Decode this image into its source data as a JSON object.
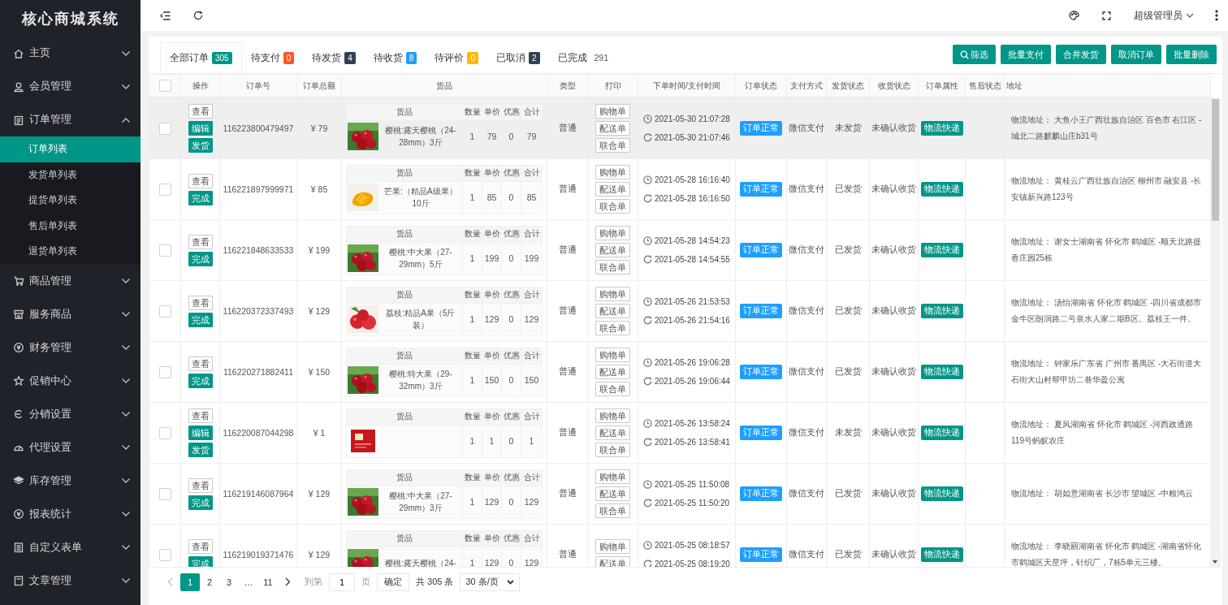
{
  "sidebar": {
    "logo": "核心商城系统",
    "items": [
      {
        "label": "主页",
        "expanded": false
      },
      {
        "label": "会员管理",
        "expanded": false
      },
      {
        "label": "订单管理",
        "expanded": true,
        "children": [
          {
            "label": "订单列表",
            "selected": true
          },
          {
            "label": "发货单列表",
            "selected": false
          },
          {
            "label": "提货单列表",
            "selected": false
          },
          {
            "label": "售后单列表",
            "selected": false
          },
          {
            "label": "退货单列表",
            "selected": false
          }
        ]
      },
      {
        "label": "商品管理",
        "expanded": false
      },
      {
        "label": "服务商品",
        "expanded": false
      },
      {
        "label": "财务管理",
        "expanded": false
      },
      {
        "label": "促销中心",
        "expanded": false
      },
      {
        "label": "分销设置",
        "expanded": false
      },
      {
        "label": "代理设置",
        "expanded": false
      },
      {
        "label": "库存管理",
        "expanded": false
      },
      {
        "label": "报表统计",
        "expanded": false
      },
      {
        "label": "自定义表单",
        "expanded": false
      },
      {
        "label": "文章管理",
        "expanded": false
      }
    ]
  },
  "topbar": {
    "user": "超级管理员"
  },
  "tabs": [
    {
      "label": "全部订单",
      "count": "305",
      "color": "#009688",
      "selected": true
    },
    {
      "label": "待支付",
      "count": "0",
      "color": "#ff5722",
      "selected": false
    },
    {
      "label": "待发货",
      "count": "4",
      "color": "#2f4056",
      "selected": false
    },
    {
      "label": "待收货",
      "count": "8",
      "color": "#1e9fff",
      "selected": false
    },
    {
      "label": "待评价",
      "count": "0",
      "color": "#ffb800",
      "selected": false
    },
    {
      "label": "已取消",
      "count": "2",
      "color": "#2f4056",
      "selected": false
    },
    {
      "label": "已完成",
      "count": "291",
      "selected": false
    }
  ],
  "toolbar": [
    "筛选",
    "批量支付",
    "合并发货",
    "取消订单",
    "批量删除"
  ],
  "table": {
    "columns": [
      "操作",
      "订单号",
      "订单总额",
      "货品",
      "类型",
      "打印",
      "下单时间/支付时间",
      "订单状态",
      "支付方式",
      "发货状态",
      "收货状态",
      "订单属性",
      "售后状态",
      "地址"
    ],
    "header_checked": false,
    "rows": [
      {
        "checked": false,
        "hovered": true,
        "actions": [
          {
            "label": "查看",
            "kind": "view"
          },
          {
            "label": "编辑",
            "kind": "primary"
          },
          {
            "label": "发货",
            "kind": "primary"
          }
        ],
        "order_no": "116223800479497",
        "total": "¥ 79",
        "goods_columns": [
          "货品",
          "数量",
          "单价",
          "优惠",
          "合计"
        ],
        "goods": {
          "name": "樱桃:露天樱桃（24-28mm）3斤",
          "qty": "1",
          "price": "79",
          "discount": "0",
          "sum": "79"
        },
        "type": "普通",
        "prints": [
          "购物单",
          "配送单",
          "联合单"
        ],
        "order_time": "2021-05-30 21:07:28",
        "pay_time": "2021-05-30 21:07:46",
        "status": "订单正常",
        "payment": "微信支付",
        "shipping": "未发货",
        "receipt": "未确认收货",
        "attribute": "物流快递",
        "address": "物流地址： 大鱼小王广西壮族自治区 百色市 右江区 -城北二路麒麟山庄b31号"
      },
      {
        "checked": false,
        "hovered": false,
        "actions": [
          {
            "label": "查看",
            "kind": "view"
          },
          {
            "label": "完成",
            "kind": "primary"
          }
        ],
        "order_no": "116221897999971",
        "total": "¥ 85",
        "goods_columns": [
          "货品",
          "数量",
          "单价",
          "优惠",
          "合计"
        ],
        "goods": {
          "name": "芒果:（精品A级果）10斤",
          "qty": "1",
          "price": "85",
          "discount": "0",
          "sum": "85"
        },
        "type": "普通",
        "prints": [
          "购物单",
          "配送单",
          "联合单"
        ],
        "order_time": "2021-05-28 16:16:40",
        "pay_time": "2021-05-28 16:16:50",
        "status": "订单正常",
        "payment": "微信支付",
        "shipping": "已发货",
        "receipt": "未确认收货",
        "attribute": "物流快递",
        "address": "物流地址： 黄桂云广西壮族自治区 柳州市 融安县 -长安镇新兴路123号"
      },
      {
        "checked": false,
        "hovered": false,
        "actions": [
          {
            "label": "查看",
            "kind": "view"
          },
          {
            "label": "完成",
            "kind": "primary"
          }
        ],
        "order_no": "116221848633533",
        "total": "¥ 199",
        "goods_columns": [
          "货品",
          "数量",
          "单价",
          "优惠",
          "合计"
        ],
        "goods": {
          "name": "樱桃:中大果（27-29mm）5斤",
          "qty": "1",
          "price": "199",
          "discount": "0",
          "sum": "199"
        },
        "type": "普通",
        "prints": [
          "购物单",
          "配送单",
          "联合单"
        ],
        "order_time": "2021-05-28 14:54:23",
        "pay_time": "2021-05-28 14:54:55",
        "status": "订单正常",
        "payment": "微信支付",
        "shipping": "已发货",
        "receipt": "未确认收货",
        "attribute": "物流快递",
        "address": "物流地址： 谢女士湖南省 怀化市 鹤城区 -顺天北路提香庄园25栋"
      },
      {
        "checked": false,
        "hovered": false,
        "actions": [
          {
            "label": "查看",
            "kind": "view"
          },
          {
            "label": "完成",
            "kind": "primary"
          }
        ],
        "order_no": "116220372337493",
        "total": "¥ 129",
        "goods_columns": [
          "货品",
          "数量",
          "单价",
          "优惠",
          "合计"
        ],
        "goods": {
          "name": "荔枝:精品A果（5斤装）",
          "qty": "1",
          "price": "129",
          "discount": "0",
          "sum": "129"
        },
        "type": "普通",
        "prints": [
          "购物单",
          "配送单",
          "联合单"
        ],
        "order_time": "2021-05-26 21:53:53",
        "pay_time": "2021-05-26 21:54:16",
        "status": "订单正常",
        "payment": "微信支付",
        "shipping": "已发货",
        "receipt": "未确认收货",
        "attribute": "物流快递",
        "address": "物流地址： 汤怡湖南省 怀化市 鹤城区 -四川省成都市金牛区朗润路二号泉水人家二期B区。荔枝王一件。"
      },
      {
        "checked": false,
        "hovered": false,
        "actions": [
          {
            "label": "查看",
            "kind": "view"
          },
          {
            "label": "完成",
            "kind": "primary"
          }
        ],
        "order_no": "116220271882411",
        "total": "¥ 150",
        "goods_columns": [
          "货品",
          "数量",
          "单价",
          "优惠",
          "合计"
        ],
        "goods": {
          "name": "樱桃:特大果（29-32mm）3斤",
          "qty": "1",
          "price": "150",
          "discount": "0",
          "sum": "150"
        },
        "type": "普通",
        "prints": [
          "购物单",
          "配送单",
          "联合单"
        ],
        "order_time": "2021-05-26 19:06:28",
        "pay_time": "2021-05-26 19:06:44",
        "status": "订单正常",
        "payment": "微信支付",
        "shipping": "已发货",
        "receipt": "未确认收货",
        "attribute": "物流快递",
        "address": "物流地址： 钟家乐广东省 广州市 番禺区 -大石街道大石街大山村帮甲坊二巷华盈公寓"
      },
      {
        "checked": false,
        "hovered": false,
        "actions": [
          {
            "label": "查看",
            "kind": "view"
          },
          {
            "label": "编辑",
            "kind": "primary"
          },
          {
            "label": "发货",
            "kind": "primary"
          }
        ],
        "order_no": "116220087044298",
        "total": "¥ 1",
        "goods_columns": [
          "货品",
          "数量",
          "单价",
          "优惠",
          "合计"
        ],
        "goods": {
          "qty": "1",
          "price": "1",
          "discount": "0",
          "sum": "1"
        },
        "type": "普通",
        "prints": [
          "购物单",
          "配送单",
          "联合单"
        ],
        "order_time": "2021-05-26 13:58:24",
        "pay_time": "2021-05-26 13:58:41",
        "status": "订单正常",
        "payment": "微信支付",
        "shipping": "未发货",
        "receipt": "未确认收货",
        "attribute": "物流快递",
        "address": "物流地址： 夏风湖南省 怀化市 鹤城区 -河西政通路119号蚂蚁农庄"
      },
      {
        "checked": false,
        "hovered": false,
        "actions": [
          {
            "label": "查看",
            "kind": "view"
          },
          {
            "label": "完成",
            "kind": "primary"
          }
        ],
        "order_no": "116219146087964",
        "total": "¥ 129",
        "goods_columns": [
          "货品",
          "数量",
          "单价",
          "优惠",
          "合计"
        ],
        "goods": {
          "name": "樱桃:中大果（27-29mm）3斤",
          "qty": "1",
          "price": "129",
          "discount": "0",
          "sum": "129"
        },
        "type": "普通",
        "prints": [
          "购物单",
          "配送单",
          "联合单"
        ],
        "order_time": "2021-05-25 11:50:08",
        "pay_time": "2021-05-25 11:50:20",
        "status": "订单正常",
        "payment": "微信支付",
        "shipping": "已发货",
        "receipt": "未确认收货",
        "attribute": "物流快递",
        "address": "物流地址： 胡如意湖南省 长沙市 望城区 -中粮鸿云"
      },
      {
        "checked": false,
        "hovered": false,
        "actions": [
          {
            "label": "查看",
            "kind": "view"
          },
          {
            "label": "完成",
            "kind": "primary"
          }
        ],
        "order_no": "116219019371476",
        "total": "¥ 129",
        "goods_columns": [
          "货品",
          "数量",
          "单价",
          "优惠",
          "合计"
        ],
        "goods": {
          "name": "樱桃:露天樱桃（24-",
          "qty": "1",
          "price": "129",
          "discount": "0",
          "sum": "129"
        },
        "type": "普通",
        "prints": [
          "购物单",
          "配送单"
        ],
        "order_time": "2021-05-25 08:18:57",
        "pay_time": "2021-05-25 08:19:20",
        "status": "订单正常",
        "payment": "微信支付",
        "shipping": "已发货",
        "receipt": "未确认收货",
        "attribute": "物流快递",
        "address": "物流地址： 李晓丽湖南省 怀化市 鹤城区 -湖南省怀化市鹤城区天星坪，针织厂，7栋5单元三楼。"
      }
    ]
  },
  "pagination": {
    "pages": [
      {
        "label": "1",
        "selected": true
      },
      {
        "label": "2",
        "selected": false
      },
      {
        "label": "3",
        "selected": false
      },
      {
        "label": "…",
        "selected": false
      },
      {
        "label": "11",
        "selected": false
      }
    ],
    "goto_label": "到第",
    "goto_value": "1",
    "page_unit": "页",
    "confirm": "确定",
    "total": "共 305 条",
    "page_size": "30 条/页"
  }
}
